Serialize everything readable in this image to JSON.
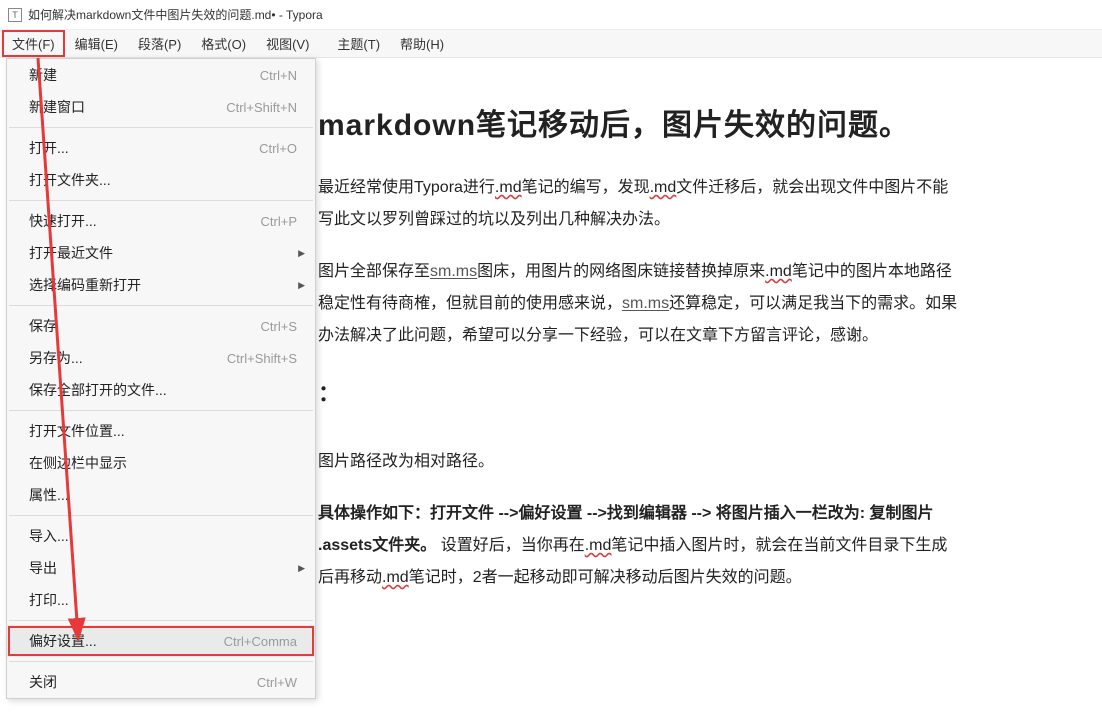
{
  "titlebar": {
    "icon": "T",
    "text": "如何解决markdown文件中图片失效的问题.md• - Typora"
  },
  "menubar": {
    "items": [
      {
        "label": "文件(F)",
        "highlighted": true
      },
      {
        "label": "编辑(E)"
      },
      {
        "label": "段落(P)"
      },
      {
        "label": "格式(O)"
      },
      {
        "label": "视图(V)"
      },
      {
        "label": "主题(T)"
      },
      {
        "label": "帮助(H)"
      }
    ]
  },
  "dropdown": {
    "groups": [
      [
        {
          "label": "新建",
          "shortcut": "Ctrl+N"
        },
        {
          "label": "新建窗口",
          "shortcut": "Ctrl+Shift+N"
        }
      ],
      [
        {
          "label": "打开...",
          "shortcut": "Ctrl+O"
        },
        {
          "label": "打开文件夹..."
        }
      ],
      [
        {
          "label": "快速打开...",
          "shortcut": "Ctrl+P"
        },
        {
          "label": "打开最近文件",
          "submenu": true
        },
        {
          "label": "选择编码重新打开",
          "submenu": true
        }
      ],
      [
        {
          "label": "保存",
          "shortcut": "Ctrl+S"
        },
        {
          "label": "另存为...",
          "shortcut": "Ctrl+Shift+S"
        },
        {
          "label": "保存全部打开的文件..."
        }
      ],
      [
        {
          "label": "打开文件位置..."
        },
        {
          "label": "在侧边栏中显示"
        },
        {
          "label": "属性..."
        }
      ],
      [
        {
          "label": "导入..."
        },
        {
          "label": "导出",
          "submenu": true
        },
        {
          "label": "打印..."
        }
      ],
      [
        {
          "label": "偏好设置...",
          "shortcut": "Ctrl+Comma",
          "highlighted": true,
          "hover": true
        }
      ],
      [
        {
          "label": "关闭",
          "shortcut": "Ctrl+W"
        }
      ]
    ]
  },
  "document": {
    "heading_suffix": "markdown笔记移动后，图片失效的问题。",
    "p1_a": "最近经常使用Typora进行",
    "md": ".md",
    "p1_b": "笔记的编写，发现",
    "p1_c": "文件迁移后，就会出现文件中图片不能",
    "p1_d": "写此文以罗列曾踩过的坑以及列出几种解决办法。",
    "p2_a": "图片全部保存至",
    "smms": "sm.ms",
    "p2_b": "图床，用图片的网络图床链接替换掉原来",
    "p2_c": "笔记中的图片本地路径",
    "p2_d": "稳定性有待商榷，但就目前的使用感来说，",
    "p2_e": "还算稳定，可以满足我当下的需求。如果",
    "p2_f": "办法解决了此问题，希望可以分享一下经验，可以在文章下方留言评论，感谢。",
    "p3": "：",
    "p4": "图片路径改为相对路径。",
    "p5_bold": "具体操作如下：打开文件 -->偏好设置 -->找到编辑器 --> 将图片插入一栏改为: 复制图片",
    "p5_bold2": ".assets文件夹。",
    "p5_b": " 设置好后，当你再在",
    "p5_c": "笔记中插入图片时，就会在当前文件目录下生成",
    "p5_d": "后再移动",
    "p5_e": "笔记时，2者一起移动即可解决移动后图片失效的问题。"
  }
}
